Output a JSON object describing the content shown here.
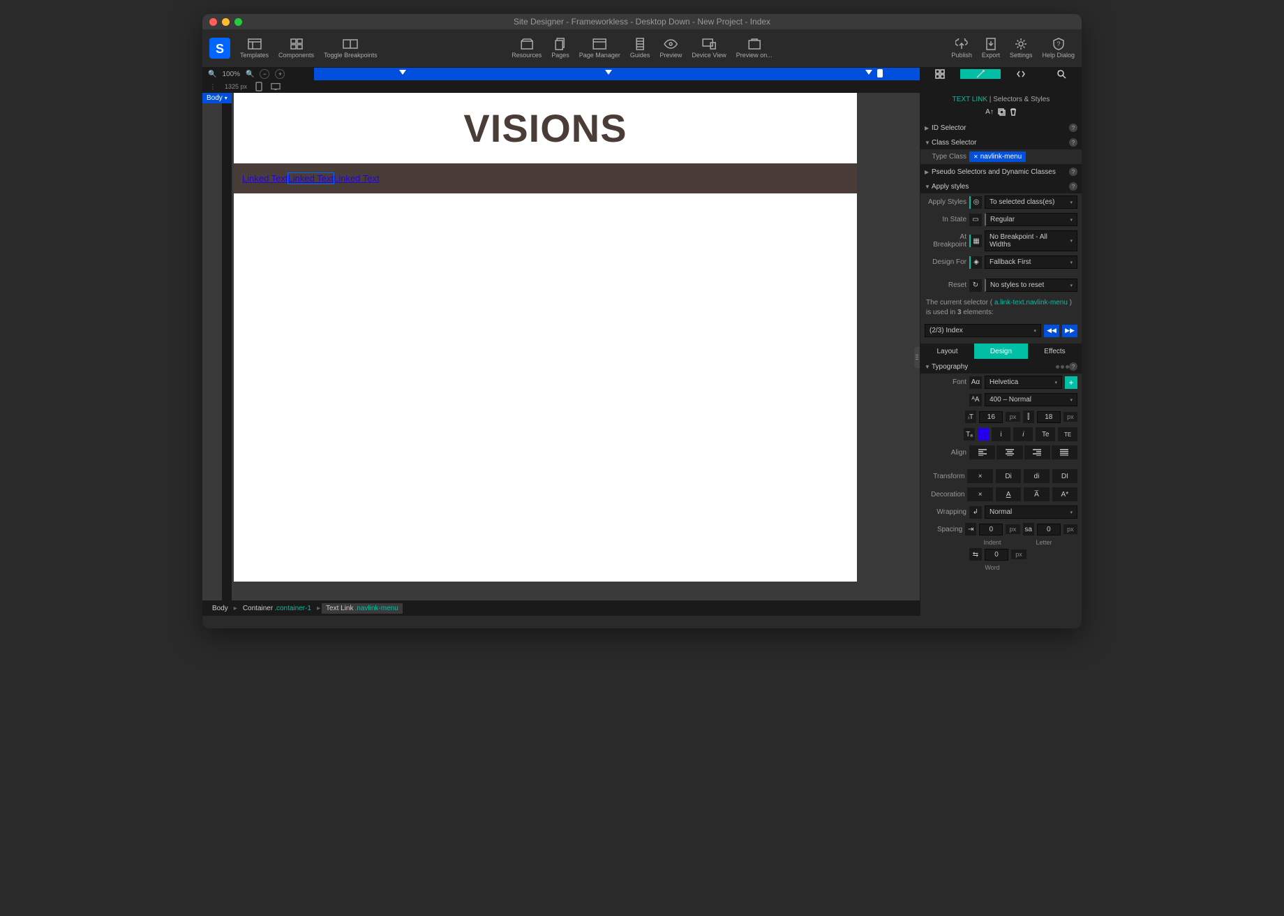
{
  "titlebar": "Site Designer - Frameworkless - Desktop Down - New Project - Index",
  "toolbar": {
    "left": [
      "Templates",
      "Components",
      "Toggle Breakpoints"
    ],
    "center": [
      "Resources",
      "Pages",
      "Page Manager",
      "Guides",
      "Preview",
      "Device View",
      "Preview on..."
    ],
    "right": [
      "Publish",
      "Export",
      "Settings",
      "Help Dialog"
    ]
  },
  "zoom": {
    "percent": "100%",
    "width_px": "1325 px"
  },
  "canvas": {
    "body_tag": "Body",
    "heading": "VISIONS",
    "links": [
      "Linked Text",
      "Linked Text",
      "Linked Text"
    ]
  },
  "breadcrumb": [
    {
      "label": "Body",
      "suffix": ""
    },
    {
      "label": "Container",
      "suffix": ".container-1"
    },
    {
      "label": "Text Link",
      "suffix": ".navlink-menu"
    }
  ],
  "panel": {
    "element_type": "TEXT LINK",
    "head_suffix": "Selectors & Styles",
    "sections": {
      "id_selector": "ID Selector",
      "class_selector": "Class Selector",
      "type_class_label": "Type Class",
      "type_class_chip": "navlink-menu",
      "pseudo": "Pseudo Selectors and Dynamic Classes",
      "apply_styles": "Apply styles"
    },
    "apply": {
      "apply_styles_label": "Apply Styles",
      "apply_styles_val": "To selected class(es)",
      "in_state_label": "In State",
      "in_state_val": "Regular",
      "at_bp_label": "At Breakpoint",
      "at_bp_val": "No Breakpoint - All Widths",
      "design_for_label": "Design For",
      "design_for_val": "Fallback First",
      "reset_label": "Reset",
      "reset_val": "No styles to reset"
    },
    "selector_info": {
      "pre": "The current selector ( ",
      "selector": "a.link-text.navlink-menu",
      "post": " ) is used in ",
      "count": "3",
      "post2": " elements:",
      "dropdown": "(2/3) Index"
    },
    "subtabs": [
      "Layout",
      "Design",
      "Effects"
    ],
    "typography": {
      "section": "Typography",
      "font_label": "Font",
      "font_val": "Helvetica",
      "weight": "400 – Normal",
      "size": "16",
      "size_unit": "px",
      "lineheight": "18",
      "lh_unit": "px",
      "variants": [
        "i",
        "i",
        "Te",
        "TE"
      ],
      "align_label": "Align",
      "transform_label": "Transform",
      "transform_opts": [
        "×",
        "Di",
        "di",
        "DI"
      ],
      "decoration_label": "Decoration",
      "decoration_opts": [
        "×",
        "A",
        "A̅",
        "A*"
      ],
      "wrapping_label": "Wrapping",
      "wrapping_val": "Normal",
      "spacing_label": "Spacing",
      "indent": "0",
      "indent_unit": "px",
      "letter": "0",
      "letter_unit": "px",
      "indent_lbl": "Indent",
      "letter_lbl": "Letter",
      "word": "0",
      "word_unit": "px",
      "word_lbl": "Word"
    }
  }
}
